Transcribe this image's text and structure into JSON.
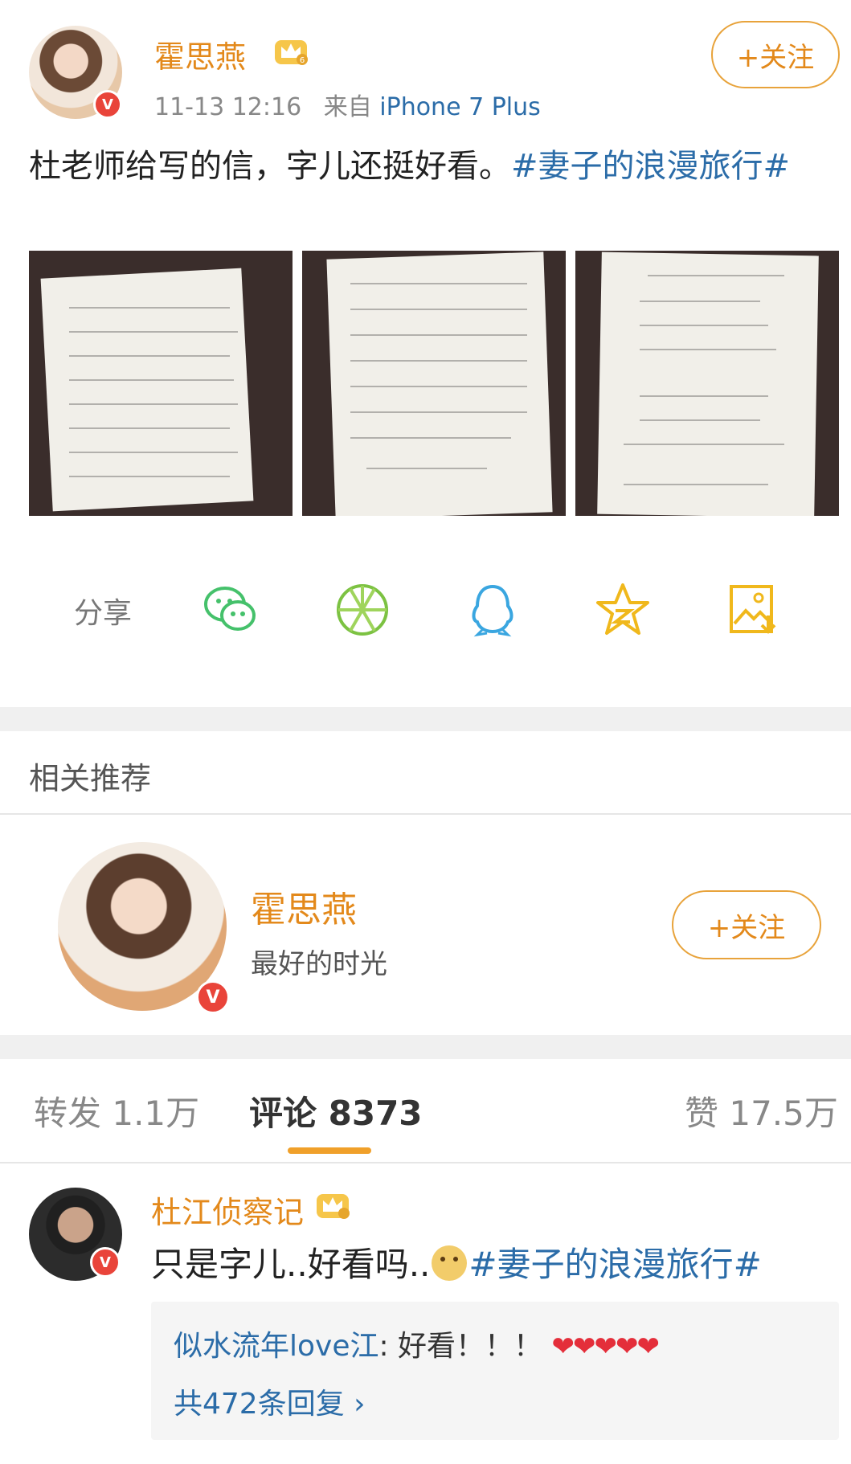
{
  "post": {
    "author": "霍思燕",
    "time": "11-13 12:16",
    "source_prefix": "来自",
    "source_device": "iPhone 7 Plus",
    "follow_label": "+关注",
    "text": "杜老师给写的信，字儿还挺好看。",
    "topic": "#妻子的浪漫旅行#",
    "badge": "V"
  },
  "share": {
    "label": "分享",
    "icons": [
      "wechat-icon",
      "moments-icon",
      "qq-icon",
      "qzone-icon",
      "save-image-icon"
    ]
  },
  "recommend": {
    "title": "相关推荐",
    "name": "霍思燕",
    "desc": "最好的时光",
    "follow_label": "+关注"
  },
  "tabs": {
    "repost": "转发 1.1万",
    "comment": "评论 8373",
    "like": "赞 17.5万"
  },
  "comment": {
    "author": "杜江侦察记",
    "text_before": "只是字儿..好看吗..",
    "topic": "#妻子的浪漫旅行#",
    "reply_user": "似水流年love江",
    "reply_text": ": 好看！！！",
    "reply_hearts": "❤❤❤❤❤",
    "reply_count": "共472条回复 ›"
  },
  "colors": {
    "accent_orange": "#e3891b",
    "link_blue": "#2b6ca8",
    "verified_red": "#e9443a"
  }
}
